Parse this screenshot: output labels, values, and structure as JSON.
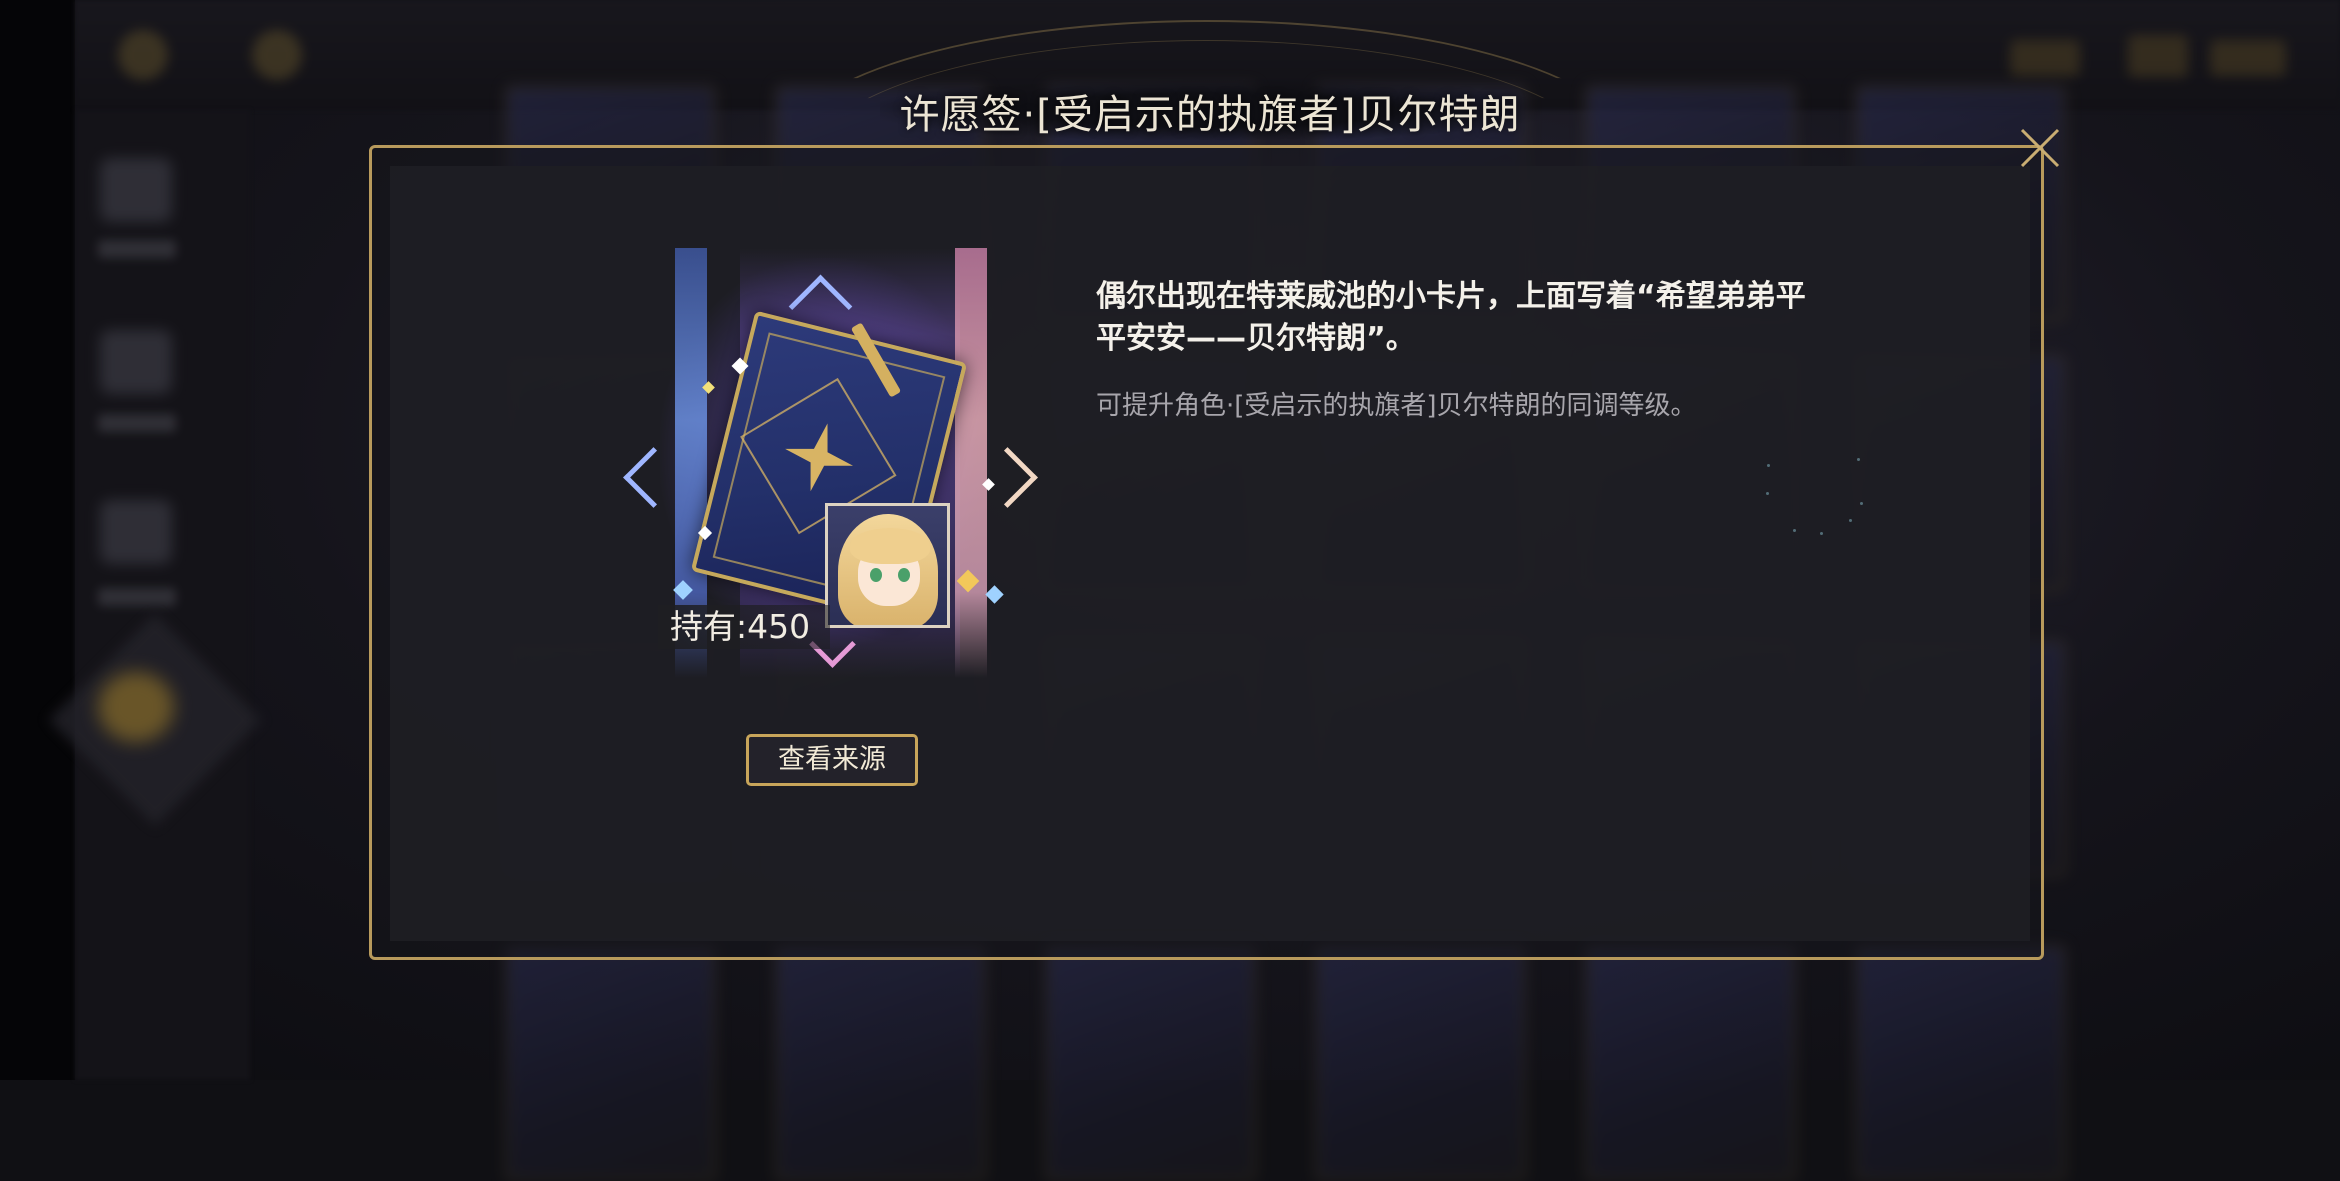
{
  "modal": {
    "title": "许愿签·[受启示的执旗者]贝尔特朗",
    "close_label": "×",
    "item": {
      "held_text": "持有:450",
      "icon": "wish-card-icon",
      "portrait": "character-portrait-icon"
    },
    "source_button_label": "查看来源",
    "description": "偶尔出现在特莱威池的小卡片，上面写着“希望弟弟平平安安——贝尔特朗”。",
    "effect": "可提升角色·[受启示的执旗者]贝尔特朗的同调等级。"
  },
  "colors": {
    "frame_gold": "#b89a5c",
    "button_border": "#c8a55a",
    "panel_bg": "#1e1e24",
    "title_text": "#ece5d4"
  }
}
